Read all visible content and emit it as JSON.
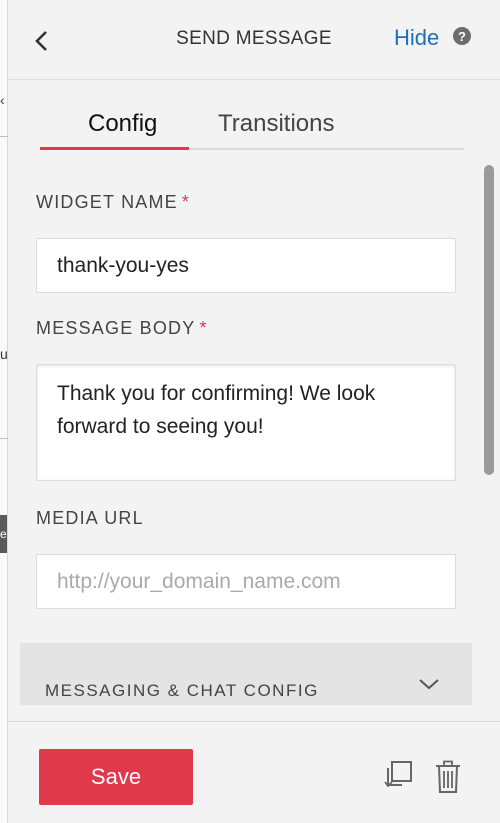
{
  "header": {
    "title": "SEND MESSAGE",
    "hide_label": "Hide",
    "help_glyph": "?"
  },
  "tabs": [
    {
      "label": "Config",
      "active": true
    },
    {
      "label": "Transitions",
      "active": false
    }
  ],
  "form": {
    "widget_name": {
      "label": "WIDGET NAME",
      "required_mark": "*",
      "value": "thank-you-yes"
    },
    "message_body": {
      "label": "MESSAGE BODY",
      "required_mark": "*",
      "value": "Thank you for confirming! We look forward to seeing you!"
    },
    "media_url": {
      "label": "MEDIA URL",
      "placeholder": "http://your_domain_name.com",
      "value": ""
    }
  },
  "accordion": {
    "label": "MESSAGING & CHAT CONFIG",
    "expanded": false
  },
  "footer": {
    "save_label": "Save"
  },
  "canvas_fragments": {
    "top": "‹",
    "middle": "u",
    "dark": "e"
  },
  "colors": {
    "accent": "#e0394a",
    "link": "#1f6fc0",
    "panel_bg": "#f3f3f3"
  },
  "icons": [
    "chevron-left-icon",
    "help-icon",
    "chevron-down-icon",
    "duplicate-icon",
    "trash-icon"
  ]
}
